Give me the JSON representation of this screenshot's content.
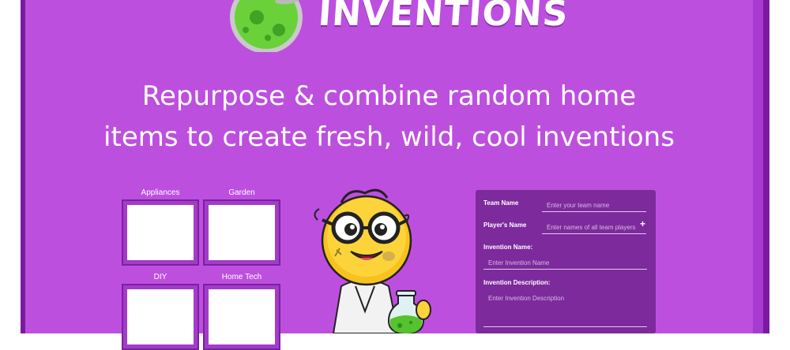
{
  "brand": {
    "logo_text": "INVENTIONS"
  },
  "hero": {
    "line1": "Repurpose & combine random home",
    "line2": "items to create fresh, wild, cool inventions"
  },
  "categories": [
    {
      "label": "Appliances"
    },
    {
      "label": "Garden"
    },
    {
      "label": "DIY"
    },
    {
      "label": "Home Tech"
    }
  ],
  "form": {
    "team_name_label": "Team Name",
    "team_name_placeholder": "Enter your team name",
    "players_label": "Player's Name",
    "players_placeholder": "Enter names of all team players",
    "add_icon": "+",
    "invention_name_label": "Invention Name:",
    "invention_name_placeholder": "Enter Invention Name",
    "description_label": "Invention Description:",
    "description_placeholder": "Enter Invention Description"
  },
  "colors": {
    "panel": "#bd4fdf",
    "frame": "#7b1aa0",
    "form_bg": "#7d2a9c"
  }
}
